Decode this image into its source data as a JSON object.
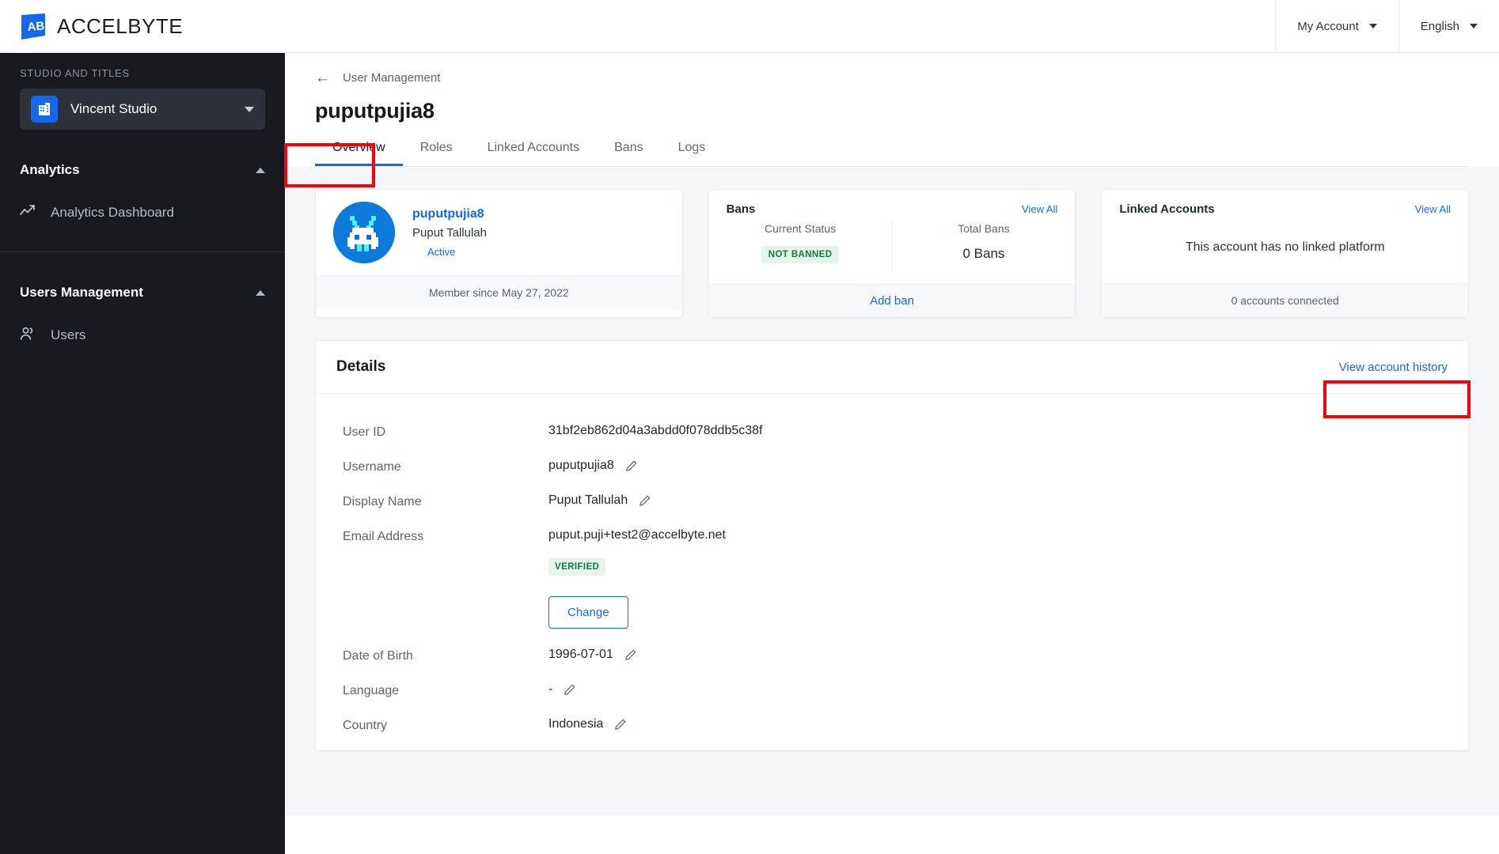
{
  "topbar": {
    "brand": "ACCELBYTE",
    "account_label": "My Account",
    "language_label": "English"
  },
  "sidebar": {
    "section_label": "STUDIO AND TITLES",
    "studio": {
      "name": "Vincent Studio"
    },
    "groups": [
      {
        "title": "Analytics",
        "items": [
          {
            "label": "Analytics Dashboard",
            "icon": "trending-up-icon"
          }
        ]
      },
      {
        "title": "Users Management",
        "items": [
          {
            "label": "Users",
            "icon": "users-icon"
          }
        ]
      }
    ]
  },
  "page": {
    "breadcrumb": "User Management",
    "title": "puputpujia8",
    "tabs": [
      {
        "label": "Overview",
        "active": true
      },
      {
        "label": "Roles",
        "active": false
      },
      {
        "label": "Linked Accounts",
        "active": false
      },
      {
        "label": "Bans",
        "active": false
      },
      {
        "label": "Logs",
        "active": false
      }
    ]
  },
  "profile_card": {
    "username": "puputpujia8",
    "display_name": "Puput Tallulah",
    "status": "Active",
    "member_since": "Member since May 27, 2022"
  },
  "bans_card": {
    "title": "Bans",
    "view_all": "View All",
    "current_status_label": "Current Status",
    "current_status_value": "NOT BANNED",
    "total_bans_label": "Total Bans",
    "total_bans_value": "0 Bans",
    "add_ban": "Add ban"
  },
  "linked_accounts_card": {
    "title": "Linked Accounts",
    "view_all": "View All",
    "empty_message": "This account has no linked platform",
    "footer": "0 accounts connected"
  },
  "details": {
    "title": "Details",
    "history_link": "View account history",
    "rows": [
      {
        "label": "User ID",
        "value": "31bf2eb862d04a3abdd0f078ddb5c38f",
        "editable": false
      },
      {
        "label": "Username",
        "value": "puputpujia8",
        "editable": true
      },
      {
        "label": "Display Name",
        "value": "Puput Tallulah",
        "editable": true
      },
      {
        "label": "Email Address",
        "value": "puput.puji+test2@accelbyte.net",
        "editable": false,
        "badge": "VERIFIED",
        "button": "Change"
      },
      {
        "label": "Date of Birth",
        "value": "1996-07-01",
        "editable": true
      },
      {
        "label": "Language",
        "value": "-",
        "editable": true
      },
      {
        "label": "Country",
        "value": "Indonesia",
        "editable": true
      }
    ]
  },
  "colors": {
    "accent": "#1468ec",
    "sidebar_bg": "#17191e",
    "page_bg": "#f4f6f8",
    "annotation": "#fb0007",
    "badge_green_bg": "#e6f5ec",
    "badge_green_text": "#137a3d"
  }
}
